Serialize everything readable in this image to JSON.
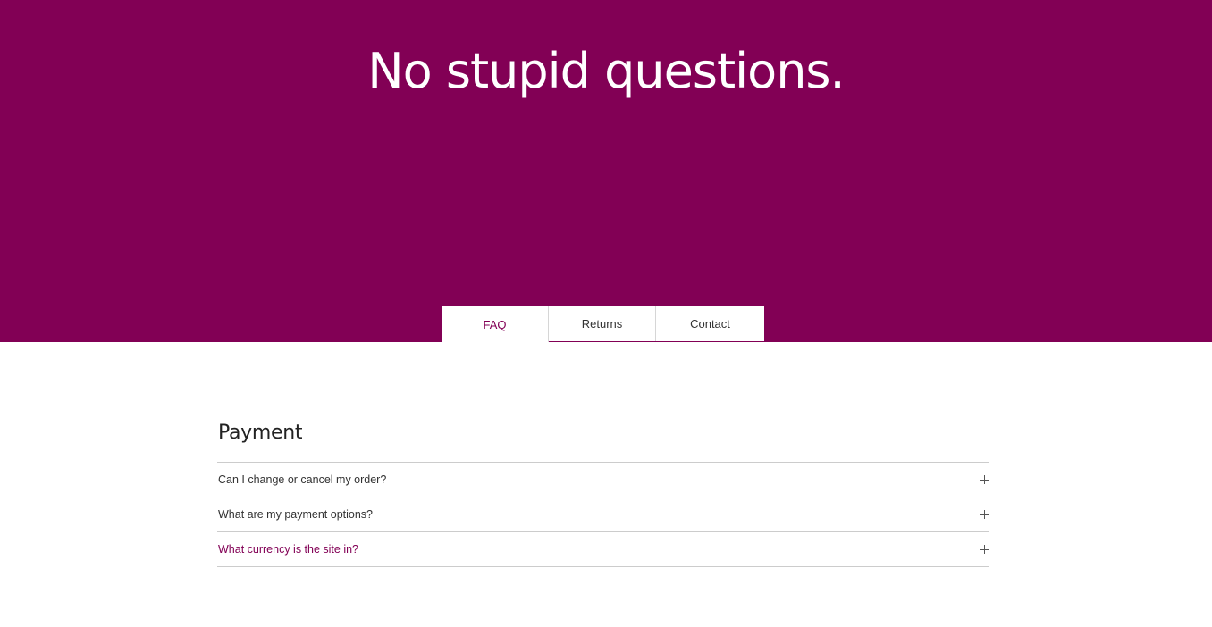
{
  "hero": {
    "title": "No stupid questions.",
    "background_color": "#820055"
  },
  "tabs": [
    {
      "label": "FAQ",
      "active": true
    },
    {
      "label": "Returns",
      "active": false
    },
    {
      "label": "Contact",
      "active": false
    }
  ],
  "faq": {
    "section_title": "Payment",
    "items": [
      {
        "question": "Can I change or cancel my order?",
        "icon": "plus-icon"
      },
      {
        "question": "What are my payment options?",
        "icon": "plus-icon"
      },
      {
        "question": "What currency is the site in?",
        "icon": "plus-icon"
      }
    ]
  },
  "colors": {
    "accent": "#820055",
    "text": "#333333",
    "divider": "#cccccc"
  }
}
